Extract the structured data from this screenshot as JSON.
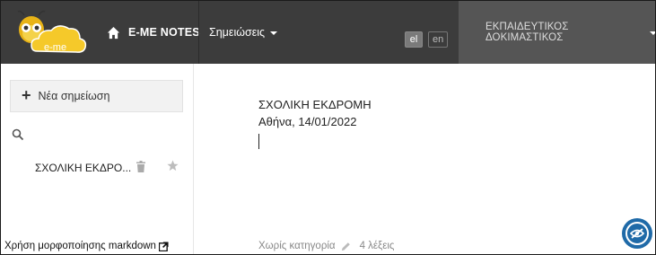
{
  "header": {
    "logo_text": "e-me",
    "brand_label": "E-ME NOTES",
    "notes_menu_label": "Σημειώσεις",
    "languages": [
      "el",
      "en"
    ],
    "active_language": "el",
    "user_name": "ΕΚΠΑΙΔΕΥΤΙΚΟΣ ΔΟΚΙΜΑΣΤΙΚΟΣ"
  },
  "sidebar": {
    "new_note_label": "Νέα σημείωση",
    "notes": [
      {
        "title": "ΣΧΟΛΙΚΗ ΕΚΔΡΟ..."
      }
    ],
    "markdown_link": "Χρήση μορφοποίησης markdown"
  },
  "editor": {
    "lines": [
      "ΣΧΟΛΙΚΗ ΕΚΔΡΟΜΗ",
      "Αθήνα, 14/01/2022"
    ],
    "category_label": "Χωρίς κατηγορία",
    "word_count": "4 λέξεις"
  },
  "colors": {
    "topbar": "#3c3c3c",
    "userbox": "#555555",
    "accent_button": "#1f6aa8"
  }
}
